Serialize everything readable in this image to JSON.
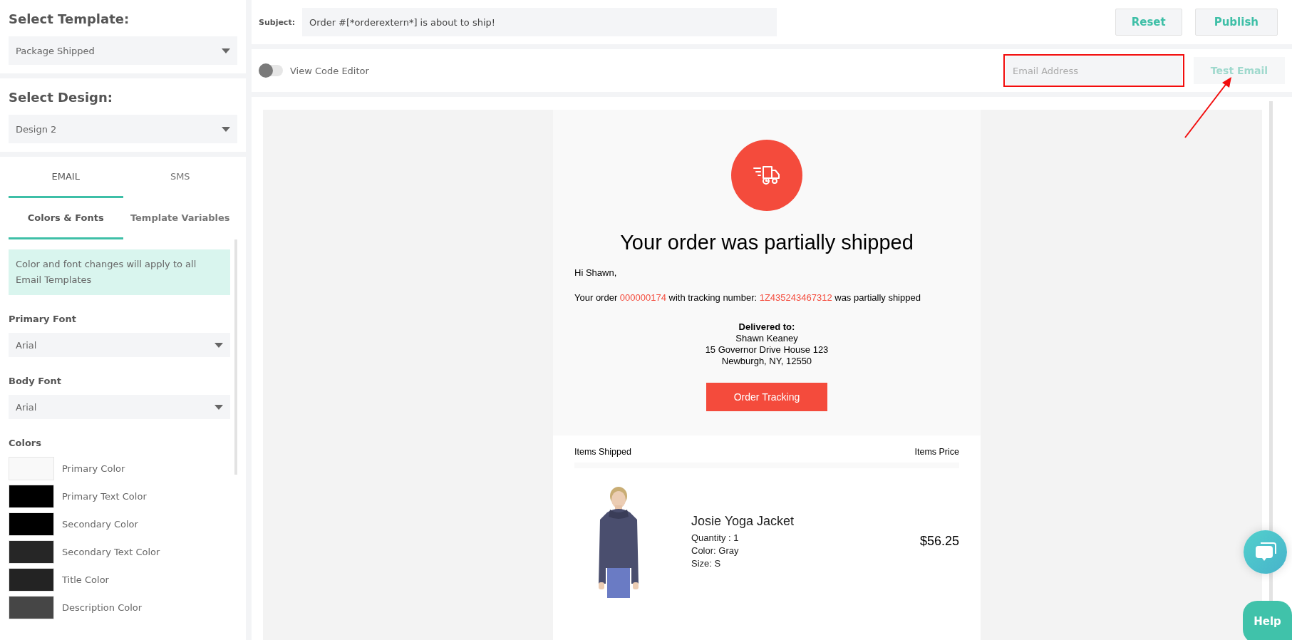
{
  "sidebar": {
    "template_label": "Select Template:",
    "template_value": "Package Shipped",
    "design_label": "Select Design:",
    "design_value": "Design 2",
    "channel_tabs": [
      {
        "label": "EMAIL",
        "selected": true
      },
      {
        "label": "SMS",
        "selected": false
      }
    ],
    "section_tabs": [
      {
        "label": "Colors & Fonts",
        "selected": true
      },
      {
        "label": "Template Variables",
        "selected": false
      }
    ],
    "notice": "Color and font changes will apply to all Email Templates",
    "fonts": [
      {
        "label": "Primary Font",
        "value": "Arial"
      },
      {
        "label": "Body Font",
        "value": "Arial"
      }
    ],
    "colors_heading": "Colors",
    "colors": [
      {
        "label": "Primary Color",
        "color": "#f9f9f9"
      },
      {
        "label": "Primary Text Color",
        "color": "#000000"
      },
      {
        "label": "Secondary Color",
        "color": "#000000"
      },
      {
        "label": "Secondary Text Color",
        "color": "#262626"
      },
      {
        "label": "Title Color",
        "color": "#232323"
      },
      {
        "label": "Description Color",
        "color": "#464646"
      }
    ]
  },
  "subject": {
    "label": "Subject:",
    "value": "Order #[*orderextern*] is about to ship!"
  },
  "buttons": [
    {
      "label": "Reset"
    },
    {
      "label": "Publish"
    }
  ],
  "code_editor": {
    "label": "View Code Editor",
    "on": false
  },
  "test_email": {
    "placeholder": "Email Address",
    "button": "Test Email",
    "disabled": true
  },
  "email": {
    "title": "Your order was partially shipped",
    "greeting": "Hi Shawn,",
    "message": [
      {
        "text": "Your order ",
        "kind": "plain"
      },
      {
        "text": "000000174",
        "kind": "highlight"
      },
      {
        "text": " with tracking number: ",
        "kind": "plain"
      },
      {
        "text": "1Z435243467312",
        "kind": "highlight"
      },
      {
        "text": " was partially shipped",
        "kind": "plain"
      }
    ],
    "delivered_label": "Delivered to:",
    "address": [
      "Shawn Keaney",
      "15 Governor Drive House 123",
      "Newburgh, NY, 12550"
    ],
    "tracking_button": "Order Tracking",
    "items_header": "Items Shipped",
    "price_header": "Items Price",
    "items": [
      {
        "name": "Josie Yoga Jacket",
        "details": [
          "Quantity : 1",
          "Color: Gray",
          "Size: S"
        ],
        "price": "$56.25"
      }
    ]
  },
  "help_button": "Help"
}
